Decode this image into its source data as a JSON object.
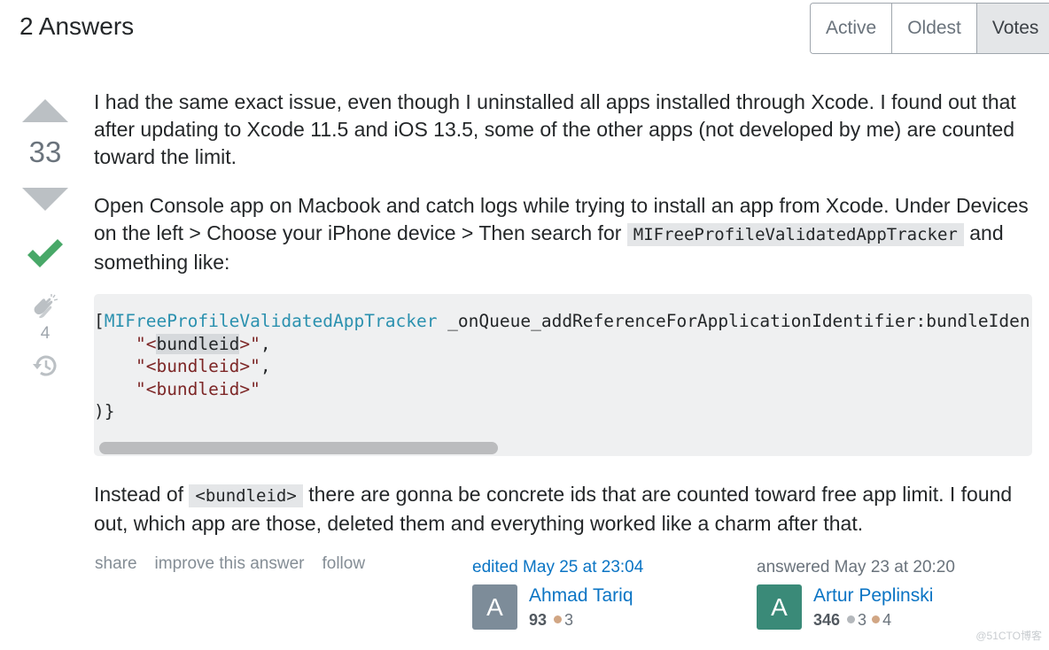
{
  "header": {
    "title": "2 Answers",
    "sort_tabs": [
      {
        "label": "Active",
        "selected": false
      },
      {
        "label": "Oldest",
        "selected": false
      },
      {
        "label": "Votes",
        "selected": true
      }
    ]
  },
  "vote": {
    "score": "33",
    "up_icon": "arrow-up-icon",
    "down_icon": "arrow-down-icon",
    "accepted": true,
    "accepted_color": "#48a868",
    "clap_count": "4"
  },
  "answer": {
    "paragraphs": {
      "p1": "I had the same exact issue, even though I uninstalled all apps installed through Xcode. I found out that after updating to Xcode 11.5 and iOS 13.5, some of the other apps (not developed by me) are counted toward the limit.",
      "p2_before": "Open Console app on Macbook and catch logs while trying to install an app from Xcode. Under Devices on the left > Choose your iPhone device > Then search for ",
      "p2_code": "MIFreeProfileValidatedAppTracker",
      "p2_after": " and something like:",
      "p3_before": "Instead of ",
      "p3_code": "<bundleid>",
      "p3_after": " there are gonna be concrete ids that are counted toward free app limit. I found out, which app are those, deleted them and everything worked like a charm after that."
    },
    "code": {
      "open_bracket": "[",
      "class_name": "MIFreeProfileValidatedAppTracker",
      "method": " _onQueue_addReferenceForApplicationIdentifier:bundleIdentifiers:(",
      "indent": "    ",
      "q": "\"",
      "lt": "<",
      "hl_word": "bundleid",
      "gt": ">",
      "line_str": "\"<bundleid>\"",
      "comma": ",",
      "close": ")}"
    }
  },
  "post_menu": [
    "share",
    "improve this answer",
    "follow"
  ],
  "editor": {
    "action": "edited May 25 at 23:04",
    "avatar_letter": "A",
    "avatar_color": "#7d8c99",
    "name": "Ahmad Tariq",
    "rep": "93",
    "badges": [
      {
        "type": "bronze",
        "count": "3",
        "color": "#d1a684"
      }
    ]
  },
  "owner": {
    "action": "answered May 23 at 20:20",
    "avatar_letter": "A",
    "avatar_color": "#3a8a78",
    "name": "Artur Peplinski",
    "rep": "346",
    "badges": [
      {
        "type": "silver",
        "count": "3",
        "color": "#b4b8bc"
      },
      {
        "type": "bronze",
        "count": "4",
        "color": "#d1a684"
      }
    ]
  },
  "watermark": "@51CTO博客"
}
